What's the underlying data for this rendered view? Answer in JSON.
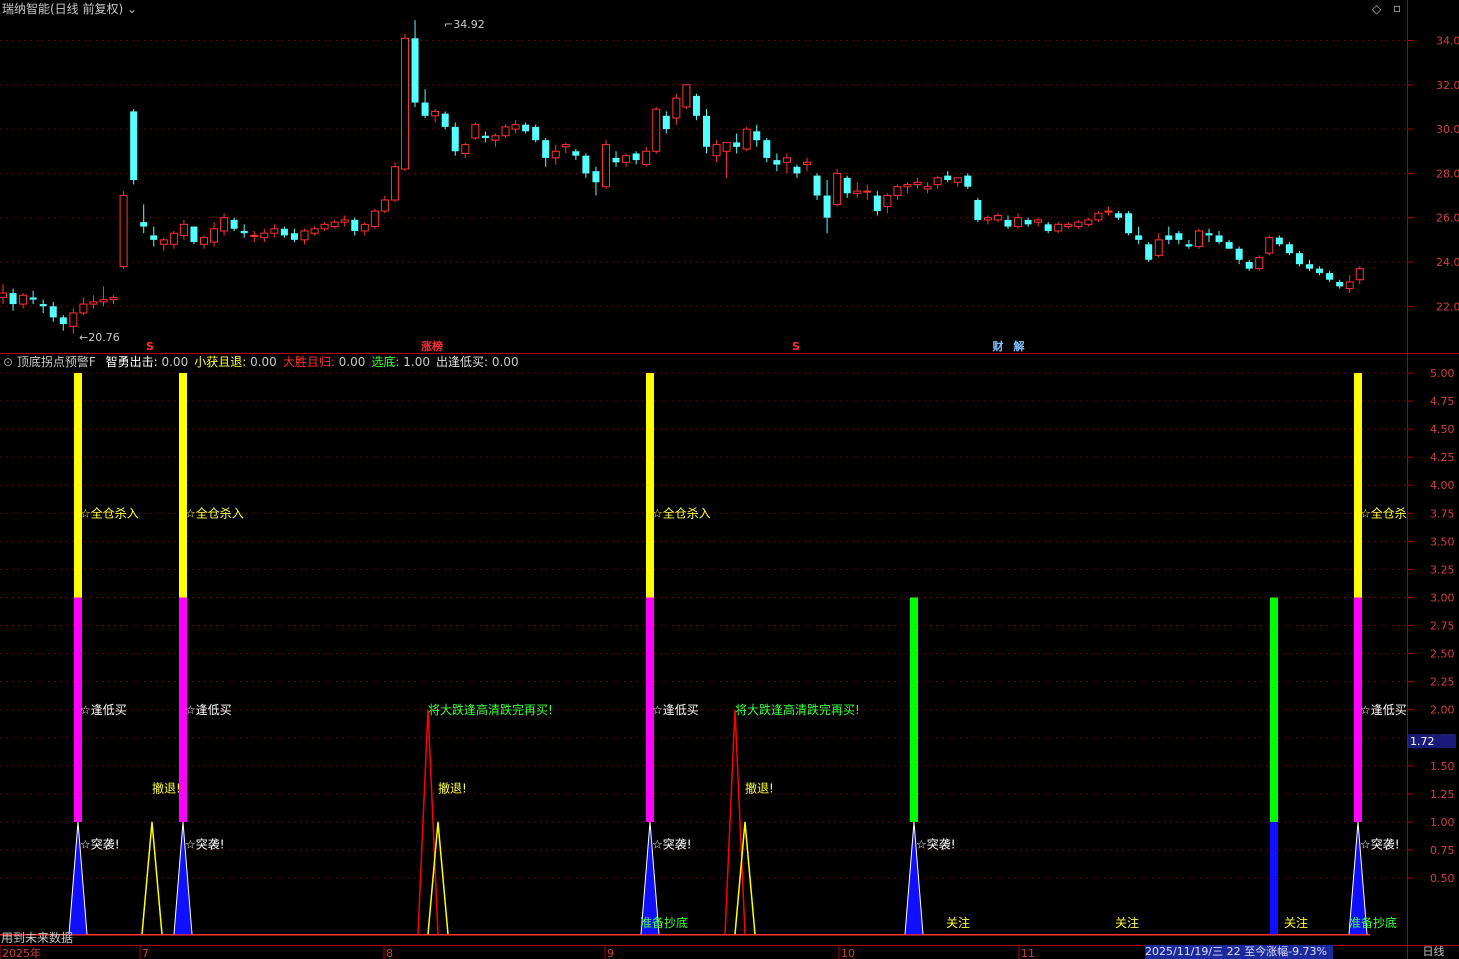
{
  "title": "瑞纳智能(日线 前复权)",
  "main_chart": {
    "y_ticks": [
      "34.00",
      "32.00",
      "30.00",
      "28.00",
      "26.00",
      "24.00",
      "22.00"
    ],
    "high_label": "34.92",
    "low_label": "20.76",
    "markers": [
      {
        "text": "S",
        "color": "#ff3030"
      },
      {
        "text": "涨榜",
        "color": "#ff3030"
      },
      {
        "text": "S",
        "color": "#ff3030"
      },
      {
        "text": "财",
        "color": "#80c0ff"
      },
      {
        "text": "解",
        "color": "#80c0ff"
      }
    ],
    "colors": {
      "up": "#ff3232",
      "down": "#54ffff"
    },
    "candles": [
      [
        22.4,
        23.0,
        22.1,
        22.6
      ],
      [
        22.6,
        22.8,
        21.8,
        22.1
      ],
      [
        22.1,
        22.6,
        21.9,
        22.5
      ],
      [
        22.4,
        22.7,
        22.1,
        22.3
      ],
      [
        22.1,
        22.3,
        21.7,
        22.0
      ],
      [
        22.0,
        22.2,
        21.3,
        21.5
      ],
      [
        21.5,
        21.6,
        20.9,
        21.2
      ],
      [
        21.1,
        21.9,
        20.76,
        21.7
      ],
      [
        21.7,
        22.4,
        21.6,
        22.1
      ],
      [
        22.1,
        22.5,
        21.9,
        22.2
      ],
      [
        22.2,
        22.9,
        22.0,
        22.3
      ],
      [
        22.3,
        22.5,
        22.1,
        22.4
      ],
      [
        23.8,
        27.2,
        23.7,
        27.0
      ],
      [
        30.8,
        30.9,
        27.5,
        27.7
      ],
      [
        25.8,
        26.6,
        25.3,
        25.6
      ],
      [
        25.2,
        25.6,
        24.7,
        25.0
      ],
      [
        24.8,
        25.1,
        24.5,
        25.0
      ],
      [
        24.8,
        25.4,
        24.6,
        25.3
      ],
      [
        25.2,
        25.9,
        25.0,
        25.7
      ],
      [
        25.6,
        25.6,
        24.8,
        24.9
      ],
      [
        24.8,
        25.2,
        24.6,
        25.1
      ],
      [
        24.9,
        25.8,
        24.7,
        25.5
      ],
      [
        25.4,
        26.2,
        25.2,
        26.0
      ],
      [
        25.9,
        26.0,
        25.4,
        25.5
      ],
      [
        25.4,
        25.7,
        25.1,
        25.3
      ],
      [
        25.2,
        25.4,
        24.9,
        25.2
      ],
      [
        25.1,
        25.5,
        24.9,
        25.3
      ],
      [
        25.3,
        25.7,
        25.1,
        25.5
      ],
      [
        25.5,
        25.6,
        25.1,
        25.2
      ],
      [
        25.3,
        25.5,
        24.9,
        25.0
      ],
      [
        25.0,
        25.5,
        24.8,
        25.4
      ],
      [
        25.3,
        25.6,
        25.2,
        25.5
      ],
      [
        25.5,
        25.8,
        25.4,
        25.7
      ],
      [
        25.6,
        25.9,
        25.5,
        25.8
      ],
      [
        25.8,
        26.1,
        25.6,
        25.9
      ],
      [
        25.9,
        26.0,
        25.2,
        25.4
      ],
      [
        25.4,
        25.8,
        25.2,
        25.7
      ],
      [
        25.6,
        26.4,
        25.5,
        26.3
      ],
      [
        26.3,
        27.0,
        26.2,
        26.8
      ],
      [
        26.8,
        28.5,
        26.7,
        28.3
      ],
      [
        28.2,
        34.3,
        28.1,
        34.1
      ],
      [
        34.1,
        34.92,
        31.0,
        31.2
      ],
      [
        31.2,
        31.8,
        30.5,
        30.6
      ],
      [
        30.6,
        30.9,
        30.3,
        30.8
      ],
      [
        30.7,
        30.8,
        30.0,
        30.1
      ],
      [
        30.1,
        30.3,
        28.8,
        29.0
      ],
      [
        28.9,
        29.4,
        28.7,
        29.3
      ],
      [
        29.6,
        30.3,
        29.5,
        30.2
      ],
      [
        29.7,
        29.9,
        29.4,
        29.6
      ],
      [
        29.5,
        29.8,
        29.2,
        29.7
      ],
      [
        29.7,
        30.2,
        29.6,
        30.1
      ],
      [
        30.0,
        30.4,
        29.8,
        30.2
      ],
      [
        30.2,
        30.3,
        29.8,
        29.9
      ],
      [
        30.1,
        30.2,
        29.4,
        29.5
      ],
      [
        29.5,
        29.6,
        28.3,
        28.7
      ],
      [
        28.7,
        29.3,
        28.4,
        29.0
      ],
      [
        29.2,
        29.4,
        28.9,
        29.3
      ],
      [
        29.0,
        29.1,
        28.6,
        28.8
      ],
      [
        28.8,
        28.9,
        27.8,
        28.0
      ],
      [
        28.1,
        28.3,
        27.0,
        27.6
      ],
      [
        27.4,
        29.5,
        27.3,
        29.3
      ],
      [
        28.7,
        29.0,
        28.3,
        28.5
      ],
      [
        28.5,
        28.9,
        28.3,
        28.8
      ],
      [
        28.9,
        29.0,
        28.4,
        28.6
      ],
      [
        28.4,
        29.2,
        28.3,
        29.0
      ],
      [
        29.0,
        31.0,
        28.9,
        30.9
      ],
      [
        30.6,
        30.8,
        29.8,
        30.0
      ],
      [
        30.5,
        31.6,
        30.2,
        31.4
      ],
      [
        31.0,
        31.9,
        30.9,
        32.0
      ],
      [
        31.5,
        31.6,
        30.4,
        30.6
      ],
      [
        30.6,
        30.9,
        28.9,
        29.2
      ],
      [
        28.8,
        29.5,
        28.5,
        29.3
      ],
      [
        29.0,
        29.4,
        27.8,
        29.4
      ],
      [
        29.4,
        29.8,
        28.9,
        29.2
      ],
      [
        29.1,
        30.1,
        29.0,
        30.0
      ],
      [
        29.9,
        30.2,
        29.2,
        29.5
      ],
      [
        29.5,
        29.6,
        28.5,
        28.7
      ],
      [
        28.6,
        28.9,
        28.1,
        28.4
      ],
      [
        28.5,
        28.9,
        28.0,
        28.7
      ],
      [
        28.3,
        28.4,
        27.8,
        28.0
      ],
      [
        28.4,
        28.7,
        28.1,
        28.5
      ],
      [
        27.9,
        28.0,
        26.8,
        27.0
      ],
      [
        27.0,
        27.7,
        25.3,
        26.0
      ],
      [
        26.6,
        28.2,
        26.5,
        28.0
      ],
      [
        27.8,
        27.9,
        26.9,
        27.1
      ],
      [
        27.1,
        27.6,
        26.9,
        27.2
      ],
      [
        27.2,
        27.5,
        26.8,
        27.2
      ],
      [
        27.0,
        27.2,
        26.1,
        26.3
      ],
      [
        26.5,
        27.1,
        26.2,
        27.0
      ],
      [
        27.0,
        27.5,
        26.8,
        27.4
      ],
      [
        27.4,
        27.6,
        27.1,
        27.5
      ],
      [
        27.5,
        27.8,
        27.3,
        27.6
      ],
      [
        27.3,
        27.6,
        27.1,
        27.4
      ],
      [
        27.5,
        27.9,
        27.3,
        27.8
      ],
      [
        27.9,
        28.1,
        27.6,
        27.7
      ],
      [
        27.6,
        27.8,
        27.4,
        27.8
      ],
      [
        27.9,
        28.0,
        27.3,
        27.4
      ],
      [
        26.8,
        26.9,
        25.8,
        25.9
      ],
      [
        25.9,
        26.1,
        25.7,
        26.0
      ],
      [
        25.9,
        26.2,
        25.8,
        26.1
      ],
      [
        25.9,
        26.1,
        25.5,
        25.6
      ],
      [
        25.6,
        26.2,
        25.5,
        26.0
      ],
      [
        25.9,
        26.0,
        25.6,
        25.7
      ],
      [
        25.8,
        26.0,
        25.6,
        25.9
      ],
      [
        25.7,
        25.8,
        25.3,
        25.4
      ],
      [
        25.4,
        25.8,
        25.3,
        25.7
      ],
      [
        25.6,
        25.8,
        25.5,
        25.7
      ],
      [
        25.6,
        25.9,
        25.5,
        25.8
      ],
      [
        25.7,
        26.0,
        25.6,
        25.9
      ],
      [
        25.9,
        26.3,
        25.8,
        26.2
      ],
      [
        26.3,
        26.5,
        26.1,
        26.3
      ],
      [
        26.2,
        26.3,
        25.9,
        26.0
      ],
      [
        26.2,
        26.3,
        25.2,
        25.3
      ],
      [
        25.2,
        25.6,
        24.8,
        25.0
      ],
      [
        24.8,
        24.9,
        24.0,
        24.1
      ],
      [
        24.3,
        25.3,
        24.2,
        25.0
      ],
      [
        25.2,
        25.6,
        24.8,
        25.0
      ],
      [
        25.3,
        25.4,
        24.8,
        25.0
      ],
      [
        24.8,
        25.0,
        24.6,
        24.7
      ],
      [
        24.7,
        25.5,
        24.6,
        25.4
      ],
      [
        25.3,
        25.5,
        24.9,
        25.2
      ],
      [
        25.2,
        25.4,
        24.8,
        24.9
      ],
      [
        24.9,
        25.0,
        24.6,
        24.6
      ],
      [
        24.6,
        24.7,
        23.9,
        24.1
      ],
      [
        24.0,
        24.1,
        23.6,
        23.7
      ],
      [
        23.7,
        24.3,
        23.6,
        24.2
      ],
      [
        24.4,
        25.2,
        24.3,
        25.1
      ],
      [
        25.1,
        25.2,
        24.7,
        24.8
      ],
      [
        24.8,
        24.9,
        24.3,
        24.4
      ],
      [
        24.4,
        24.5,
        23.8,
        23.9
      ],
      [
        23.9,
        24.1,
        23.6,
        23.7
      ],
      [
        23.7,
        23.8,
        23.4,
        23.5
      ],
      [
        23.5,
        23.6,
        23.1,
        23.2
      ],
      [
        23.1,
        23.2,
        22.8,
        22.9
      ],
      [
        22.8,
        23.4,
        22.6,
        23.1
      ],
      [
        23.2,
        23.8,
        23.0,
        23.7
      ]
    ]
  },
  "indicator": {
    "name": "顶底拐点预警F",
    "params": [
      {
        "label": "智勇出击:",
        "value": "0.00",
        "color": "#ffffff"
      },
      {
        "label": "小获且退:",
        "value": "0.00",
        "color": "#ffff40"
      },
      {
        "label": "大胜且归:",
        "value": "0.00",
        "color": "#ff3030"
      },
      {
        "label": "选底:",
        "value": "1.00",
        "color": "#40ff40"
      },
      {
        "label": "出逢低买:",
        "value": "0.00",
        "color": "#e0e0e0"
      }
    ],
    "y_ticks": [
      "5.00",
      "4.75",
      "4.50",
      "4.25",
      "4.00",
      "3.75",
      "3.50",
      "3.25",
      "3.00",
      "2.75",
      "2.50",
      "2.25",
      "2.00",
      "1.75",
      "1.50",
      "1.25",
      "1.00",
      "0.75",
      "0.50"
    ],
    "current_value": "1.72",
    "annotations": {
      "all_in": "☆全仓杀入",
      "all_in_cut": "☆全仓杀",
      "low_buy": "☆逢低买",
      "sudden": "☆突袭!",
      "retreat": "撤退!",
      "big_drop": "将大跌逢高清跌完再买!",
      "prepare": "准备抄底",
      "watch": "关注"
    },
    "footer_note": "用到未来数据"
  },
  "x_axis": {
    "labels": [
      "2025年",
      "7",
      "8",
      "9",
      "10",
      "11"
    ],
    "status_date": "2025/11/19/三 22 至今涨幅-9.73%",
    "period_tab": "日线"
  }
}
